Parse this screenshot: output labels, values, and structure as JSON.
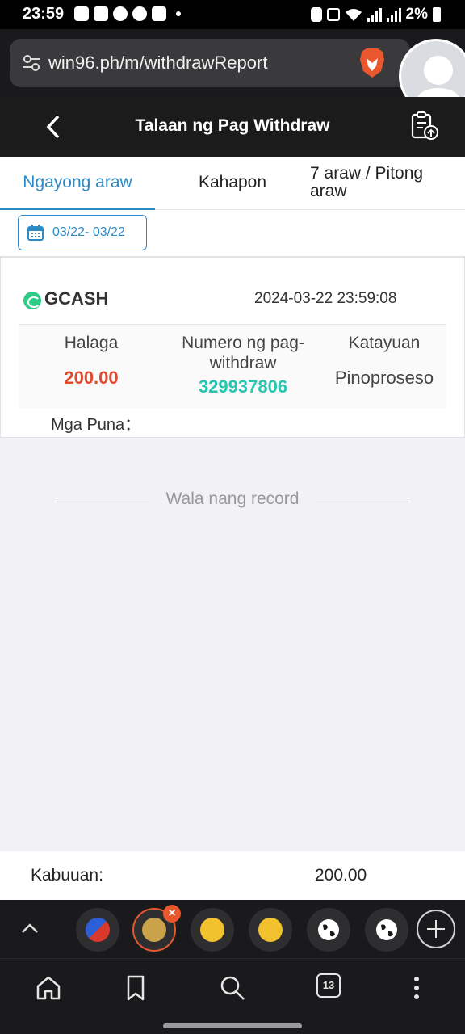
{
  "status_bar": {
    "time": "23:59",
    "battery": "2%"
  },
  "browser": {
    "url": "win96.ph/m/withdrawReport"
  },
  "header": {
    "title": "Talaan ng Pag Withdraw"
  },
  "tabs": [
    {
      "label": "Ngayong araw",
      "active": true
    },
    {
      "label": "Kahapon",
      "active": false
    },
    {
      "label": "7 araw / Pitong araw",
      "active": false
    }
  ],
  "date_filter": {
    "range": "03/22- 03/22"
  },
  "record": {
    "method": "GCASH",
    "timestamp": "2024-03-22 23:59:08",
    "amount_label": "Halaga",
    "number_label": "Numero ng pag-withdraw",
    "status_label": "Katayuan",
    "amount": "200.00",
    "withdraw_number": "329937806",
    "status": "Pinoproseso",
    "remarks_label": "Mga Puna："
  },
  "no_more_label": "Wala nang record",
  "total": {
    "label": "Kabuuan:",
    "value": "200.00"
  },
  "browser_tabs": {
    "count": "13"
  },
  "colors": {
    "accent": "#2c8bc6",
    "amount": "#e04a2e",
    "number": "#26c6b0",
    "brave": "#e8572e"
  }
}
